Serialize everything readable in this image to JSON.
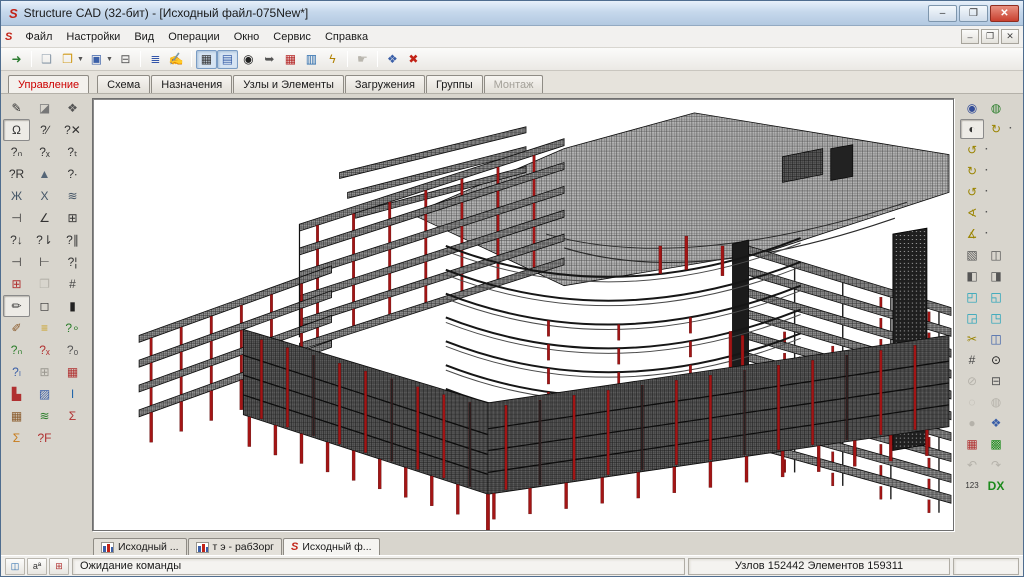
{
  "window": {
    "title": "Structure CAD (32-бит) - [Исходный файл-075New*]",
    "buttons": [
      {
        "name": "minimize-button",
        "glyph": "–"
      },
      {
        "name": "restore-button",
        "glyph": "❐"
      },
      {
        "name": "close-button",
        "glyph": "✕",
        "close": true
      }
    ],
    "mdi_buttons": [
      {
        "name": "mdi-minimize-button",
        "glyph": "–"
      },
      {
        "name": "mdi-restore-button",
        "glyph": "❐"
      },
      {
        "name": "mdi-close-button",
        "glyph": "✕"
      }
    ]
  },
  "menu": {
    "items": [
      "Файл",
      "Настройки",
      "Вид",
      "Операции",
      "Окно",
      "Сервис",
      "Справка"
    ]
  },
  "toolbar": {
    "buttons": [
      {
        "name": "project-exit",
        "glyph": "➜",
        "color": "#2e7d32",
        "sep_after": true
      },
      {
        "name": "new-document",
        "glyph": "❑",
        "color": "#8898a8"
      },
      {
        "name": "open-file",
        "glyph": "❒",
        "color": "#d09a1a",
        "dd": true
      },
      {
        "name": "save-file",
        "glyph": "▣",
        "color": "#3a5fa8",
        "dd": true
      },
      {
        "name": "print",
        "glyph": "⊟",
        "color": "#555555",
        "sep_after": true
      },
      {
        "name": "project-tree",
        "glyph": "≣",
        "color": "#3355aa"
      },
      {
        "name": "edit-schema",
        "glyph": "✍",
        "color": "#444444",
        "sep_after": true
      },
      {
        "name": "model-solid-view",
        "glyph": "▦",
        "color": "#333333",
        "pressed": true
      },
      {
        "name": "model-frame-view",
        "glyph": "▤",
        "color": "#3a5fa8",
        "pressed": true
      },
      {
        "name": "snapshot-camera",
        "glyph": "◉",
        "color": "#222222"
      },
      {
        "name": "export-fragment",
        "glyph": "➥",
        "color": "#555555"
      },
      {
        "name": "table-input",
        "glyph": "▦",
        "color": "#b32020"
      },
      {
        "name": "results-monitor",
        "glyph": "▥",
        "color": "#2266aa"
      },
      {
        "name": "run-calculation",
        "glyph": "ϟ",
        "color": "#b08000",
        "sep_after": true
      },
      {
        "name": "pan-tool",
        "glyph": "☛",
        "color": "#b9b6ae",
        "disabled": true,
        "sep_after": true
      },
      {
        "name": "window-settings",
        "glyph": "❖",
        "color": "#3a5fa8"
      },
      {
        "name": "close-schema",
        "glyph": "✖",
        "color": "#c22317"
      }
    ]
  },
  "tabs": {
    "items": [
      {
        "label": "Управление",
        "state": "active"
      },
      {
        "label": "Схема",
        "state": "normal"
      },
      {
        "label": "Назначения",
        "state": "normal"
      },
      {
        "label": "Узлы и Элементы",
        "state": "normal"
      },
      {
        "label": "Загружения",
        "state": "normal"
      },
      {
        "label": "Группы",
        "state": "normal"
      },
      {
        "label": "Монтаж",
        "state": "disabled"
      }
    ]
  },
  "left_palette": {
    "items": [
      {
        "name": "draw-pencil",
        "glyph": "✎"
      },
      {
        "name": "erase",
        "glyph": "◪",
        "color": "#777777"
      },
      {
        "name": "volumetric-body",
        "glyph": "❖",
        "color": "#555555"
      },
      {
        "name": "element-info",
        "glyph": "Ω",
        "pressed": true
      },
      {
        "name": "rod-type",
        "glyph": "?∕"
      },
      {
        "name": "node-delete",
        "glyph": "?✕"
      },
      {
        "name": "rigidity-n",
        "glyph": "?ₙ"
      },
      {
        "name": "rigidity-x",
        "glyph": "?ₓ"
      },
      {
        "name": "rigidity-t",
        "glyph": "?ₜ"
      },
      {
        "name": "restraints",
        "glyph": "?R"
      },
      {
        "name": "supports",
        "glyph": "▲",
        "color": "#556677"
      },
      {
        "name": "elastic-base",
        "glyph": "?∙"
      },
      {
        "name": "merge-bars",
        "glyph": "Ж",
        "color": "#445566"
      },
      {
        "name": "cross-bars",
        "glyph": "Х",
        "color": "#445566"
      },
      {
        "name": "parallel-bars",
        "glyph": "≋",
        "color": "#445566"
      },
      {
        "name": "trim-bars",
        "glyph": "⊣"
      },
      {
        "name": "angle-tool",
        "glyph": "∠"
      },
      {
        "name": "mesh-table",
        "glyph": "⊞"
      },
      {
        "name": "load-node",
        "glyph": "?↓"
      },
      {
        "name": "load-point",
        "glyph": "?⇂"
      },
      {
        "name": "load-line",
        "glyph": "?∥"
      },
      {
        "name": "join-node-left",
        "glyph": "⊣"
      },
      {
        "name": "join-node-right",
        "glyph": "⊢"
      },
      {
        "name": "load-temp",
        "glyph": "?¦"
      },
      {
        "name": "add-mesh",
        "glyph": "⊞",
        "color": "#b03030"
      },
      {
        "name": "copy-fragment",
        "glyph": "❐",
        "disabled": true
      },
      {
        "name": "hash-grid",
        "glyph": "#",
        "color": "#444444"
      },
      {
        "name": "solid-brush",
        "glyph": "✏",
        "pressed": true
      },
      {
        "name": "cube-tool",
        "glyph": "◻"
      },
      {
        "name": "column-light",
        "glyph": "▮",
        "color": "#222222"
      },
      {
        "name": "paint-elements",
        "glyph": "✐",
        "color": "#8a5a2a"
      },
      {
        "name": "layer-stack",
        "glyph": "≡",
        "color": "#caa020"
      },
      {
        "name": "node-mark",
        "glyph": "?∘",
        "color": "#2a7d2a"
      },
      {
        "name": "group-n",
        "glyph": "?ₙ",
        "color": "#2a7d2a"
      },
      {
        "name": "group-x",
        "glyph": "?ₓ",
        "color": "#b03030"
      },
      {
        "name": "group-o",
        "glyph": "?ₒ",
        "color": "#555555"
      },
      {
        "name": "group-l",
        "glyph": "?ₗ",
        "color": "#3a5fa8"
      },
      {
        "name": "light-grid",
        "glyph": "⊞",
        "color": "#9a978f"
      },
      {
        "name": "red-grid",
        "glyph": "▦",
        "color": "#b03030"
      },
      {
        "name": "color-scale",
        "glyph": "▙",
        "color": "#b03030"
      },
      {
        "name": "color-elements",
        "glyph": "▨",
        "color": "#3a5fa8"
      },
      {
        "name": "steel-beam",
        "glyph": "I",
        "color": "#2266aa"
      },
      {
        "name": "group-cube",
        "glyph": "▦",
        "color": "#8a5a2a"
      },
      {
        "name": "color-layers",
        "glyph": "≋",
        "color": "#2a7d2a"
      },
      {
        "name": "sum-squares",
        "glyph": "Σ",
        "color": "#b03030"
      },
      {
        "name": "sum-loads",
        "glyph": "Σ",
        "color": "#c77b1a"
      },
      {
        "name": "force-f",
        "glyph": "?F",
        "color": "#b03030"
      }
    ]
  },
  "right_palette": {
    "rows": [
      [
        {
          "name": "orbit-3d",
          "glyph": "◉",
          "color": "#334d99"
        },
        {
          "name": "fly-view",
          "glyph": "◍",
          "color": "#2a7d2a"
        }
      ],
      [
        {
          "name": "rotate-view",
          "glyph": "◐",
          "pressed": true
        },
        {
          "name": "rotate-x-cw",
          "glyph": "↻",
          "color": "#9a8400",
          "dd": true
        }
      ],
      [
        {
          "name": "rotate-x-ccw",
          "glyph": "↺",
          "color": "#9a8400",
          "dd": true
        }
      ],
      [
        {
          "name": "rotate-z-cw",
          "glyph": "↻",
          "color": "#9a8400",
          "dd": true
        }
      ],
      [
        {
          "name": "rotate-z-ccw",
          "glyph": "↺",
          "color": "#9a8400",
          "dd": true
        }
      ],
      [
        {
          "name": "rotate-angle-up",
          "glyph": "∢",
          "color": "#9a8400",
          "dd": true
        }
      ],
      [
        {
          "name": "rotate-angle-down",
          "glyph": "∡",
          "color": "#9a8400",
          "dd": true
        }
      ],
      [
        {
          "name": "wire-cube",
          "glyph": "▧",
          "color": "#555555"
        },
        {
          "name": "cube-front-view",
          "glyph": "◫",
          "color": "#555555"
        }
      ],
      [
        {
          "name": "cube-top-view",
          "glyph": "◧",
          "color": "#555555"
        },
        {
          "name": "cube-side-view",
          "glyph": "◨",
          "color": "#555555"
        }
      ],
      [
        {
          "name": "iso-view-1",
          "glyph": "◰",
          "color": "#18a0b8"
        },
        {
          "name": "iso-view-2",
          "glyph": "◱",
          "color": "#18a0b8"
        }
      ],
      [
        {
          "name": "iso-view-3",
          "glyph": "◲",
          "color": "#18a0b8"
        },
        {
          "name": "iso-view-4",
          "glyph": "◳",
          "color": "#18a0b8"
        }
      ],
      [
        {
          "name": "cut-fragment",
          "glyph": "✂",
          "color": "#9a8400"
        },
        {
          "name": "fragment-window",
          "glyph": "◫",
          "color": "#3a5fa8"
        }
      ],
      [
        {
          "name": "fence-select",
          "glyph": "#",
          "color": "#444444"
        },
        {
          "name": "zoom-in",
          "glyph": "⊙",
          "color": "#222222"
        }
      ],
      [
        {
          "name": "zoom-out",
          "glyph": "⊘",
          "disabled": true
        },
        {
          "name": "print-view",
          "glyph": "⊟",
          "color": "#555555"
        }
      ],
      [
        {
          "name": "pan-view",
          "glyph": "◌",
          "disabled": true
        },
        {
          "name": "shade-view",
          "glyph": "◍",
          "disabled": true
        }
      ],
      [
        {
          "name": "render-view",
          "glyph": "●",
          "disabled": true
        },
        {
          "name": "refresh-view",
          "glyph": "❖",
          "color": "#3a5fa8"
        }
      ],
      [
        {
          "name": "red-mesh-toggle",
          "glyph": "▦",
          "color": "#b03030"
        },
        {
          "name": "green-mesh-toggle",
          "glyph": "▩",
          "color": "#1c8a1c"
        }
      ],
      [
        {
          "name": "undo-view",
          "glyph": "↶",
          "disabled": true
        },
        {
          "name": "redo-view",
          "glyph": "↷",
          "disabled": true
        }
      ],
      [
        {
          "name": "node-numbers",
          "glyph": "123"
        },
        {
          "name": "dx-export",
          "glyph": "DX",
          "color": "#1c8a1c"
        }
      ]
    ]
  },
  "bottom_tabs": {
    "items": [
      {
        "label": "Исходный ...",
        "icon": "chart"
      },
      {
        "label": "т э - раб3орг",
        "icon": "chart"
      },
      {
        "label": "Исходный ф...",
        "icon": "scad",
        "active": true
      }
    ]
  },
  "status": {
    "buttons": [
      {
        "name": "filter-elements",
        "glyph": "◫",
        "color": "#2266aa"
      },
      {
        "name": "font-size",
        "glyph": "aª",
        "color": "#333333"
      },
      {
        "name": "node-grid-info",
        "glyph": "⊞",
        "color": "#b03030"
      }
    ],
    "message": "Ожидание команды",
    "counts": "Узлов 152442 Элементов 159311"
  },
  "model": {
    "description": "3D structural model of multi-storey building, grey meshed slabs with red columns",
    "tower_floors": 10,
    "wing_a_floors": 6,
    "wing_b_floors": 4,
    "atrium_arcs": 7,
    "colors": {
      "column": "#a31515",
      "mesh_light": "#b3b3b3",
      "mesh_mid": "#939393",
      "mesh_dark": "#5e5e5e",
      "edge": "#0b0b0b"
    }
  }
}
